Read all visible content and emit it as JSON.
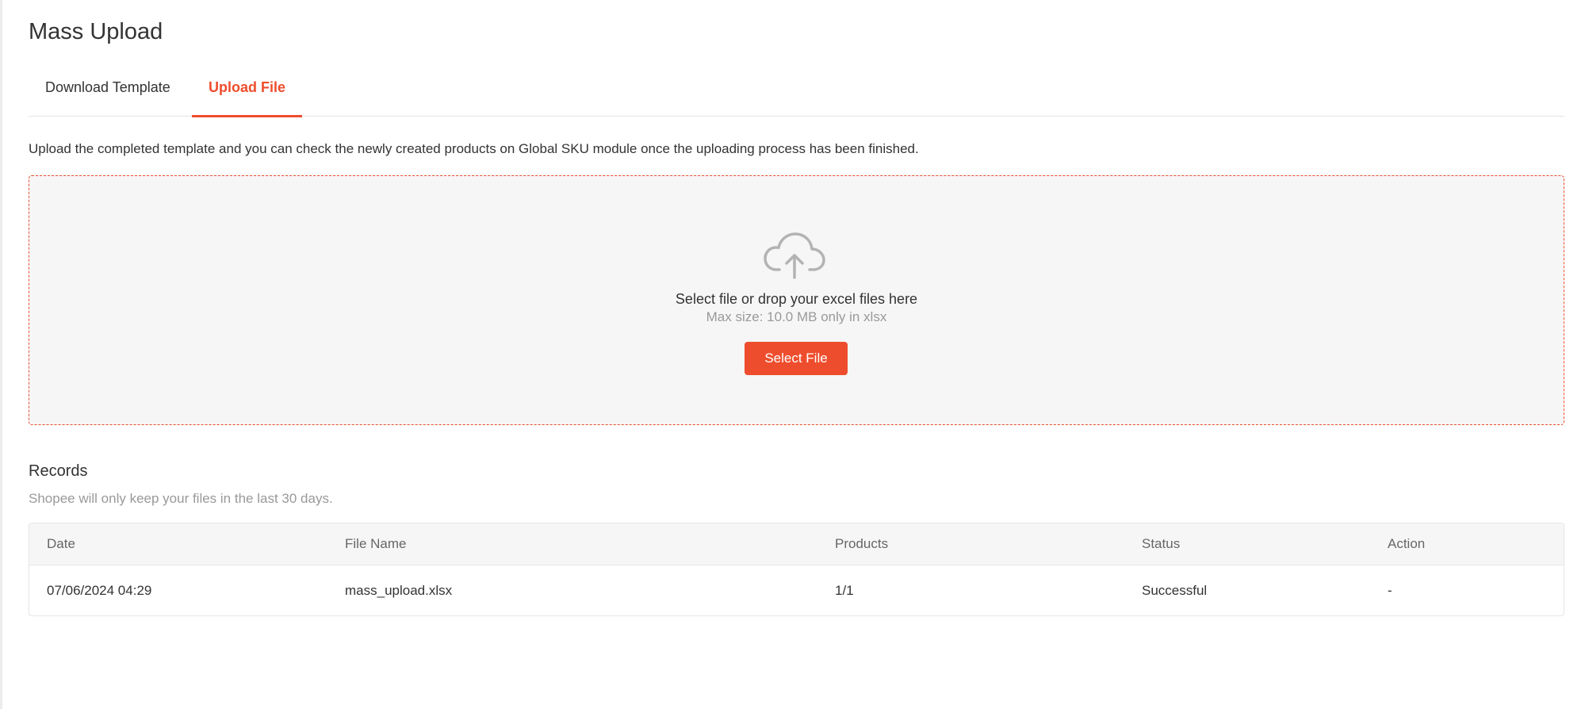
{
  "page": {
    "title": "Mass Upload"
  },
  "tabs": [
    {
      "label": "Download Template",
      "active": false
    },
    {
      "label": "Upload File",
      "active": true
    }
  ],
  "upload": {
    "description": "Upload the completed template and you can check the newly created products on Global SKU module once the uploading process has been finished.",
    "dropzone_title": "Select file or drop your excel files here",
    "dropzone_hint": "Max size: 10.0 MB only in xlsx",
    "button_label": "Select File",
    "icon": "cloud-upload-icon"
  },
  "records": {
    "title": "Records",
    "subtitle": "Shopee will only keep your files in the last 30 days.",
    "columns": [
      "Date",
      "File Name",
      "Products",
      "Status",
      "Action"
    ],
    "rows": [
      {
        "date": "07/06/2024 04:29",
        "file_name": "mass_upload.xlsx",
        "products": "1/1",
        "status": "Successful",
        "action": "-"
      }
    ]
  },
  "colors": {
    "accent": "#ee4d2d",
    "text": "#333333",
    "muted": "#999999",
    "dropzone_bg": "#f6f6f6"
  }
}
